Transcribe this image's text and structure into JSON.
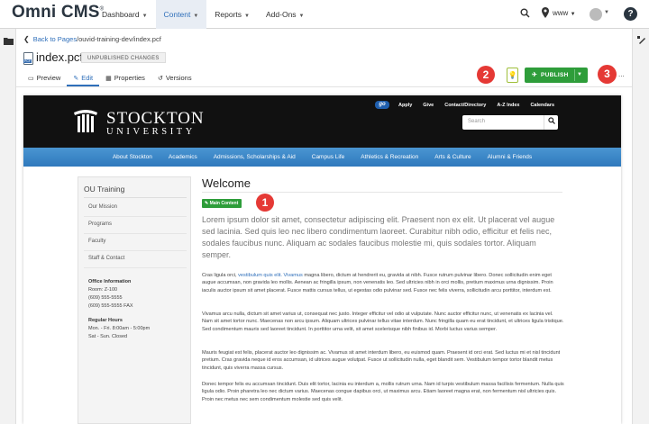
{
  "app": {
    "logo": "Omni CMS",
    "logo_mark": "®",
    "nav": [
      {
        "label": "Dashboard",
        "active": false
      },
      {
        "label": "Content",
        "active": true
      },
      {
        "label": "Reports",
        "active": false
      },
      {
        "label": "Add-Ons",
        "active": false
      }
    ],
    "site": "www",
    "help_label": "?"
  },
  "page": {
    "back_label": "Back to Pages",
    "path": "/ouvid-training-dev/index.pcf",
    "file_type": "PCF",
    "filename": "index.pcf",
    "status": "UNPUBLISHED CHANGES",
    "tabs": [
      {
        "label": "Preview",
        "icon": "monitor-icon",
        "active": false
      },
      {
        "label": "Edit",
        "icon": "pencil-icon",
        "active": true
      },
      {
        "label": "Properties",
        "icon": "properties-icon",
        "active": false
      },
      {
        "label": "Versions",
        "icon": "history-icon",
        "active": false
      }
    ],
    "publish_label": "PUBLISH",
    "more_label": "...",
    "markers": [
      "1",
      "2",
      "3"
    ]
  },
  "site": {
    "name": "STOCKTON",
    "subname": "UNIVERSITY",
    "go_badge": "go",
    "util_links": [
      "Apply",
      "Give",
      "Contact/Directory",
      "A-Z Index",
      "Calendars"
    ],
    "search_placeholder": "Search",
    "nav": [
      "About Stockton",
      "Academics",
      "Admissions, Scholarships & Aid",
      "Campus Life",
      "Athletics & Recreation",
      "Arts & Culture",
      "Alumni & Friends"
    ]
  },
  "sidebar": {
    "title": "OU Training",
    "items": [
      "Our Mission",
      "Programs",
      "Faculty",
      "Staff & Contact"
    ],
    "office_title": "Office Information",
    "office_lines": [
      "Room: Z-100",
      "(609) 555-5555",
      "(609) 555-5555 FAX"
    ],
    "hours_title": "Regular Hours",
    "hours_lines": [
      "Mon. - Fri.   8:00am - 5:00pm",
      "Sat - Sun. Closed"
    ]
  },
  "content": {
    "heading": "Welcome",
    "main_content_label": "Main Content",
    "lead": "Lorem ipsum dolor sit amet, consectetur adipiscing elit. Praesent non ex elit. Ut placerat vel augue sed lacinia. Sed quis leo nec libero condimentum laoreet. Curabitur nibh odio, efficitur et felis nec, sodales faucibus nunc. Aliquam ac sodales faucibus molestie mi, quis sodales tortor. Aliquam semper.",
    "p1_start": "Cras ligula orci,",
    "p1_link": "vestibulum quis elit. Vivamus",
    "p1_rest": " magna libero, dictum at hendrerit eu, gravida at nibh. Fusce rutrum pulvinar libero. Donec sollicitudin enim eget augue accumsan, non gravida leo mollis. Aenean ac fringilla ipsum, non venenatis leo. Sed ultricies nibh in orci mollis, pretium maximus urna dignissim. Proin iaculis auctor ipsum sit amet placerat. Fusce mattis cursus tellus, ut egestas odio pulvinar sed. Fusce nec felis viverra, sollicitudin arcu porttitor, interdum est.",
    "p2": "Vivamus arcu nulla, dictum sit amet varius ut, consequat nec justo. Integer efficitur vel odio at vulputate. Nunc auctor efficitur nunc, ut venenatis ex lacinia vel. Nam sit amet tortor nunc. Maecenas non arcu ipsum. Aliquam ultrices pulvinar tellus vitae interdum. Nunc fringilla quam eu erat tincidunt, et ultrices ligula tristique. Sed condimentum mauris sed laoreet tincidunt. In porttitor urna velit, sit amet scelerisque nibh finibus id. Morbi luctus varius semper.",
    "p3": "Mauris feugiat est felis, placerat auctor leo dignissim ac. Vivamus sit amet interdum libero, eu euismod quam. Praesent id orci erat. Sed luctus mi et nisl tincidunt pretium. Cras gravida neque id eros accumsan, id ultrices augue volutpat. Fusce ut sollicitudin nulla, eget blandit sem. Vestibulum tempor tortor blandit metus tincidunt, quis viverra massa cursus.",
    "p4": "Donec tempor felis eu accumsan tincidunt. Duis elit tortor, lacinia eu interdum a, mollis rutrum urna. Nam id turpis vestibulum massa facilisis fermentum. Nulla quis ligula odio. Proin pharetra leo nec dictum varius. Maecenas congue dapibus orci, ut maximus arcu. Etiam laoreet magna erat, non fermentum nisl ultricies quis. Proin nec metus nec sem condimentum molestie sed quis velit."
  },
  "colors": {
    "accent": "#2f6fba",
    "publish_green": "#2e9d3a",
    "marker_red": "#e53935",
    "site_nav_blue": "#3a86c8"
  }
}
